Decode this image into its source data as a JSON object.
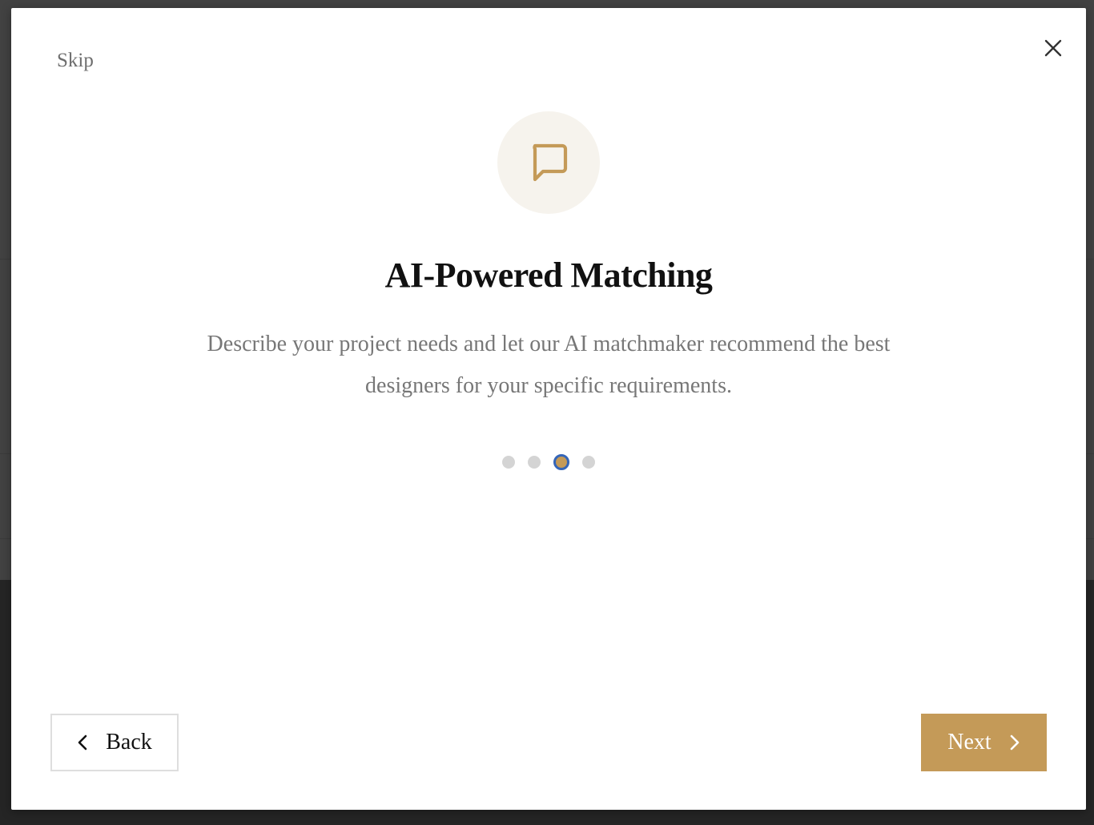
{
  "onboarding": {
    "skip_label": "Skip",
    "title": "AI-Powered Matching",
    "description": "Describe your project needs and let our AI matchmaker recommend the best designers for your specific requirements.",
    "icon": "chat-bubble-icon",
    "steps_total": 4,
    "current_step": 3,
    "back_label": "Back",
    "next_label": "Next"
  },
  "colors": {
    "accent": "#c49a58",
    "icon_bg": "#f6f3ed",
    "active_dot_ring": "#3465b8"
  }
}
